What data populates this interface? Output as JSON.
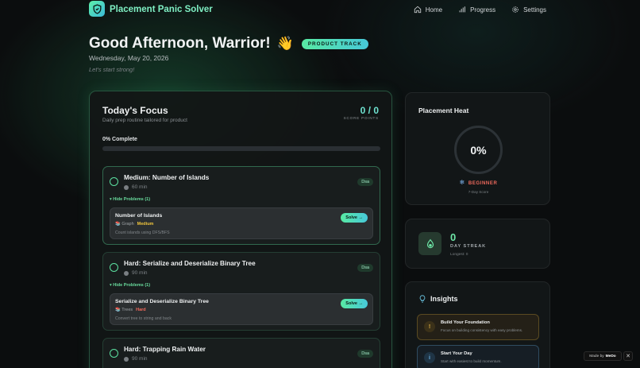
{
  "app": {
    "name": "Placement Panic Solver",
    "icon": "shield-check-icon",
    "accent": "#58eaa3",
    "accent2": "#47c8d9"
  },
  "nav": [
    {
      "label": "Home",
      "icon": "home-icon"
    },
    {
      "label": "Progress",
      "icon": "bar-chart-icon"
    },
    {
      "label": "Settings",
      "icon": "gear-icon"
    }
  ],
  "greeting": {
    "title": "Good Afternoon, Warrior!",
    "emoji": "👋",
    "badge": "PRODUCT TRACK",
    "date": "Wednesday, May 20, 2026",
    "tagline": "Let's start strong!"
  },
  "focus": {
    "title": "Today's Focus",
    "subtitle": "Daily prep routine tailored for product",
    "score": "0 / 0",
    "score_label": "SCORE POINTS",
    "complete_label": "0% Complete",
    "progress": 0,
    "tasks": [
      {
        "title": "Medium: Number of Islands",
        "time": "60 min",
        "category": "Dsa",
        "toggle": "▾ Hide Problems (1)",
        "problem": {
          "title": "Number of Islands",
          "topic": "📚 Graph",
          "difficulty": "Medium",
          "desc": "Count islands using DFS/BFS",
          "action": "Solve →"
        }
      },
      {
        "title": "Hard: Serialize and Deserialize Binary Tree",
        "time": "90 min",
        "category": "Dsa",
        "toggle": "▾ Hide Problems (1)",
        "problem": {
          "title": "Serialize and Deserialize Binary Tree",
          "topic": "📚 Trees",
          "difficulty": "Hard",
          "desc": "Convert tree to string and back",
          "action": "Solve →"
        }
      },
      {
        "title": "Hard: Trapping Rain Water",
        "time": "90 min",
        "category": "Dsa"
      }
    ]
  },
  "heat": {
    "title": "Placement Heat",
    "value": "0%",
    "level": "BEGINNER",
    "level_icon": "snowflake-icon",
    "caption": "7-Day Score"
  },
  "streak": {
    "value": "0",
    "label": "DAY STREAK",
    "longest": "Longest: 0",
    "icon": "flame-icon"
  },
  "insights": {
    "title": "Insights",
    "icon": "lightbulb-icon",
    "items": [
      {
        "title": "Build Your Foundation",
        "desc": "Focus on building consistency with easy problems.",
        "icon": "!"
      },
      {
        "title": "Start Your Day",
        "desc": "Start with easiest to build momentum.",
        "icon": "i"
      }
    ]
  },
  "footer": {
    "made_by": "Made by",
    "brand": "MeDo",
    "close": "✕"
  }
}
